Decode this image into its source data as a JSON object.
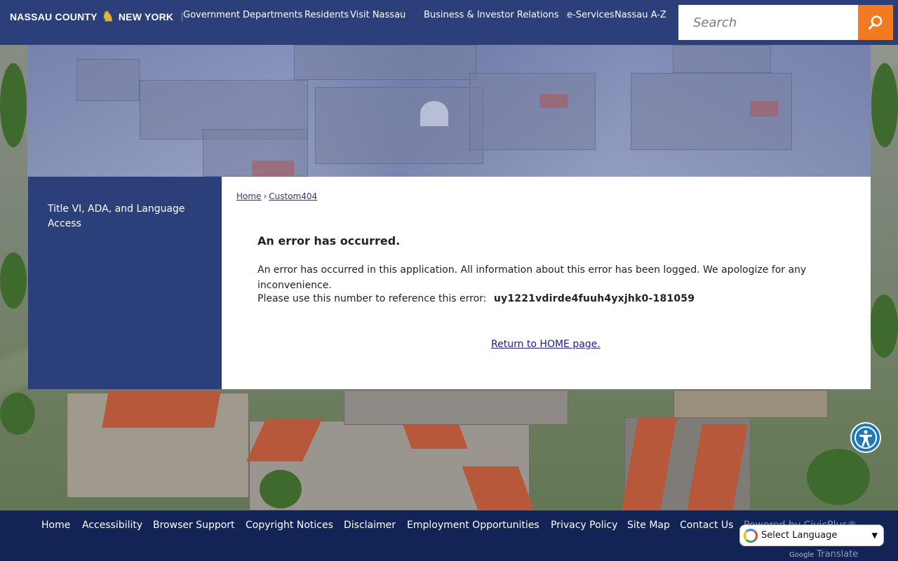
{
  "header": {
    "logo_left": "NASSAU COUNTY",
    "logo_right": "NEW YORK",
    "nav": [
      "Government",
      "Departments",
      "Residents",
      "Visit Nassau",
      "Business & Investor Relations",
      "e-Services",
      "Nassau A-Z"
    ],
    "search_placeholder": "Search"
  },
  "sidebar": {
    "link": "Title VI, ADA, and Language Access"
  },
  "breadcrumb": {
    "home": "Home",
    "separator": "›",
    "current": "Custom404"
  },
  "error": {
    "title": "An error has occurred.",
    "message": "An error has occurred in this application. All information about this error has been logged. We apologize for any inconvenience.",
    "reference_label": "Please use this number to reference this error:",
    "reference_code": "uy1221vdirde4fuuh4yxjhk0-181059",
    "home_link": "Return to HOME page."
  },
  "footer": {
    "links": [
      "Home",
      "Accessibility",
      "Browser Support",
      "Copyright Notices",
      "Disclaimer",
      "Employment Opportunities",
      "Privacy Policy",
      "Site Map",
      "Contact Us"
    ],
    "powered": "Powered by CivicPlus®"
  },
  "translate": {
    "select_label": "Select Language",
    "google": "Google",
    "translate": "Translate"
  },
  "colors": {
    "header_bg": "#2b3f7a",
    "search_button": "#f27b22",
    "footer_bg": "#122456",
    "a11y_button": "#1c7ab8"
  }
}
